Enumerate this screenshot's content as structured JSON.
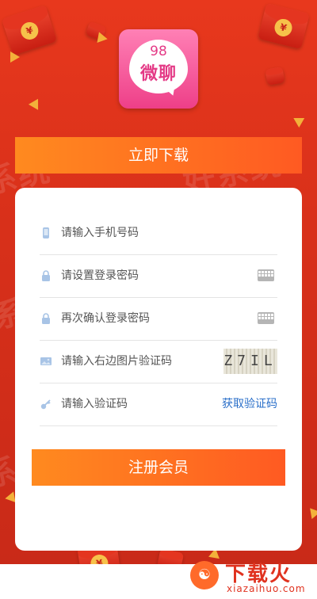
{
  "app": {
    "logo_number": "98",
    "logo_name": "微聊"
  },
  "header": {
    "download_label": "立即下载"
  },
  "form": {
    "phone_placeholder": "请输入手机号码",
    "password_placeholder": "请设置登录密码",
    "confirm_placeholder": "再次确认登录密码",
    "captcha_placeholder": "请输入右边图片验证码",
    "captcha_text": "Z7IL",
    "sms_placeholder": "请输入验证码",
    "get_code_label": "获取验证码",
    "register_label": "注册会员"
  },
  "watermark": {
    "site_name": "下载火",
    "site_url": "xiazaihuo.com"
  },
  "colors": {
    "background": "#d8301a",
    "button_start": "#ff8a1f",
    "button_end": "#ff5a22",
    "link": "#2a6fc9"
  }
}
